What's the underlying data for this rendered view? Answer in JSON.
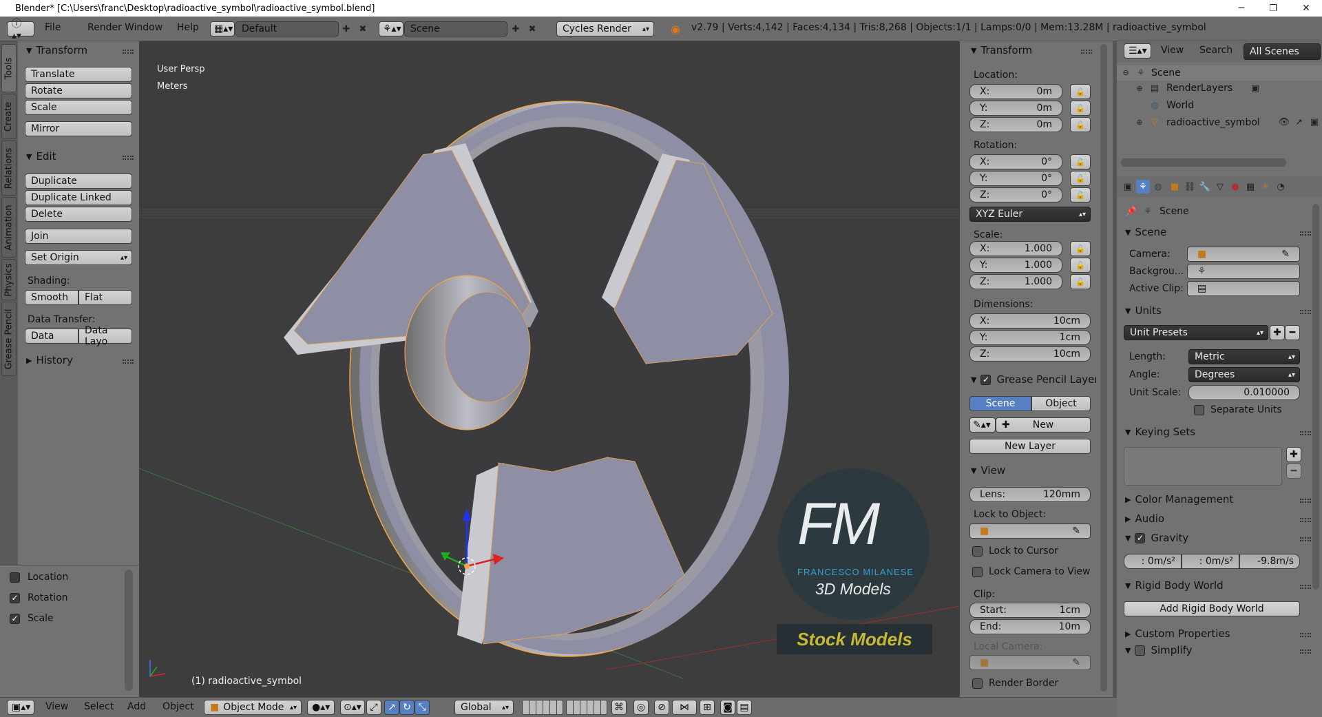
{
  "window": {
    "title": "Blender* [C:\\Users\\franc\\Desktop\\radioactive_symbol\\radioactive_symbol.blend]",
    "minimize": "─",
    "maximize": "❐",
    "close": "✕"
  },
  "header": {
    "menus": [
      "File",
      "Render",
      "Window",
      "Help"
    ],
    "layout": "Default",
    "scene": "Scene",
    "engine": "Cycles Render",
    "stats": "v2.79 | Verts:4,142 | Faces:4,134 | Tris:8,268 | Objects:1/1 | Lamps:0/0 | Mem:13.28M | radioactive_symbol"
  },
  "tool_tabs": [
    "Tools",
    "Create",
    "Relations",
    "Animation",
    "Physics",
    "Grease Pencil"
  ],
  "tools": {
    "transform_title": "Transform",
    "translate": "Translate",
    "rotate": "Rotate",
    "scale": "Scale",
    "mirror": "Mirror",
    "edit_title": "Edit",
    "duplicate": "Duplicate",
    "duplicate_linked": "Duplicate Linked",
    "delete": "Delete",
    "join": "Join",
    "set_origin": "Set Origin",
    "shading_label": "Shading:",
    "smooth": "Smooth",
    "flat": "Flat",
    "data_transfer_label": "Data Transfer:",
    "data": "Data",
    "data_layo": "Data Layo",
    "history": "History",
    "keying": [
      {
        "label": "Location",
        "checked": false
      },
      {
        "label": "Rotation",
        "checked": true
      },
      {
        "label": "Scale",
        "checked": true
      }
    ]
  },
  "viewport": {
    "persp": "User Persp",
    "units": "Meters",
    "object_label": "(1) radioactive_symbol",
    "colors": {
      "bg": "#3d3d3d",
      "mesh": "#8e8ea4",
      "select": "#f2a540"
    }
  },
  "watermark": {
    "initials": "FM",
    "name": "FRANCESCO MILANESE",
    "sub": "3D Models",
    "banner": "Stock Models"
  },
  "view_header": {
    "menus": [
      "View",
      "Select",
      "Add",
      "Object"
    ],
    "mode": "Object Mode",
    "orientation": "Global"
  },
  "properties_n": {
    "transform_title": "Transform",
    "location_label": "Location:",
    "location": [
      {
        "axis": "X:",
        "value": "0m"
      },
      {
        "axis": "Y:",
        "value": "0m"
      },
      {
        "axis": "Z:",
        "value": "0m"
      }
    ],
    "rotation_label": "Rotation:",
    "rotation": [
      {
        "axis": "X:",
        "value": "0°"
      },
      {
        "axis": "Y:",
        "value": "0°"
      },
      {
        "axis": "Z:",
        "value": "0°"
      }
    ],
    "rotation_mode": "XYZ Euler",
    "scale_label": "Scale:",
    "scale": [
      {
        "axis": "X:",
        "value": "1.000"
      },
      {
        "axis": "Y:",
        "value": "1.000"
      },
      {
        "axis": "Z:",
        "value": "1.000"
      }
    ],
    "dimensions_label": "Dimensions:",
    "dimensions": [
      {
        "axis": "X:",
        "value": "10cm"
      },
      {
        "axis": "Y:",
        "value": "1cm"
      },
      {
        "axis": "Z:",
        "value": "10cm"
      }
    ],
    "gp_title": "Grease Pencil Layer",
    "gp_scene": "Scene",
    "gp_object": "Object",
    "gp_new": "New",
    "gp_new_layer": "New Layer",
    "view_title": "View",
    "lens_label": "Lens:",
    "lens_value": "120mm",
    "lock_to_object": "Lock to Object:",
    "lock_to_cursor": "Lock to Cursor",
    "lock_camera": "Lock Camera to View",
    "clip_label": "Clip:",
    "clip_start_label": "Start:",
    "clip_start": "1cm",
    "clip_end_label": "End:",
    "clip_end": "10m",
    "local_camera": "Local Camera:",
    "render_border": "Render Border"
  },
  "outliner": {
    "menus": [
      "View",
      "Search"
    ],
    "filter": "All Scenes",
    "items": [
      "Scene",
      "RenderLayers",
      "World",
      "radioactive_symbol"
    ]
  },
  "scene_props": {
    "context": "Scene",
    "scene_title": "Scene",
    "camera_label": "Camera:",
    "background_label": "Backgrou...",
    "active_clip_label": "Active Clip:",
    "units_title": "Units",
    "unit_presets": "Unit Presets",
    "length_label": "Length:",
    "length": "Metric",
    "angle_label": "Angle:",
    "angle": "Degrees",
    "unit_scale_label": "Unit Scale:",
    "unit_scale": "0.010000",
    "separate_units": "Separate Units",
    "keying_sets": "Keying Sets",
    "color_management": "Color Management",
    "audio": "Audio",
    "gravity": "Gravity",
    "gravity_values": [
      ": 0m/s²",
      ": 0m/s²",
      "-9.8m/s"
    ],
    "rigid_body_world": "Rigid Body World",
    "add_rigid_body_world": "Add Rigid Body World",
    "custom_properties": "Custom Properties",
    "simplify": "Simplify"
  }
}
